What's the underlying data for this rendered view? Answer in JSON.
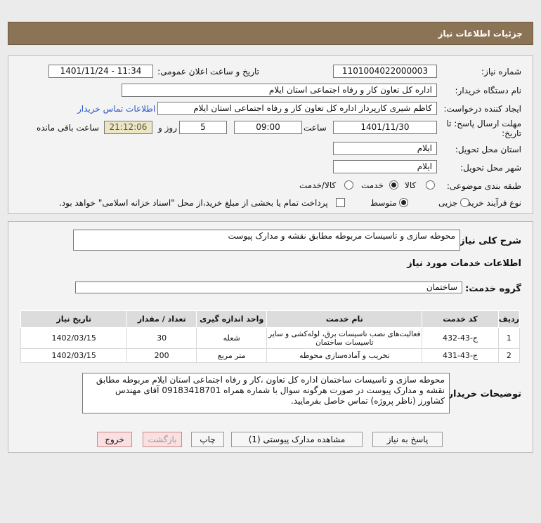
{
  "header": {
    "title": "جزئیات اطلاعات نیاز"
  },
  "form": {
    "need_number_label": "شماره نیاز:",
    "need_number": "1101004022000003",
    "announce_label": "تاریخ و ساعت اعلان عمومی:",
    "announce_value": "1401/11/24 - 11:34",
    "buyer_org_label": "نام دستگاه خریدار:",
    "buyer_org": "اداره کل تعاون  کار و رفاه اجتماعی استان ایلام",
    "requester_label": "ایجاد کننده درخواست:",
    "requester": "کاظم شیری کارپرداز اداره کل تعاون  کار و رفاه اجتماعی استان ایلام",
    "contact_link": "اطلاعات تماس خریدار",
    "deadline_label_1": "مهلت ارسال پاسخ: تا",
    "deadline_label_2": "تاریخ:",
    "deadline_date": "1401/11/30",
    "time_label": "ساعت",
    "deadline_time": "09:00",
    "days_value": "5",
    "days_label": "روز و",
    "remaining_time": "21:12:06",
    "remaining_label": "ساعت باقی مانده",
    "province_label": "استان محل تحویل:",
    "province": "ایلام",
    "city_label": "شهر محل تحویل:",
    "city": "ایلام",
    "category_label": "طبقه بندی موضوعی:",
    "category_options": [
      "کالا",
      "خدمت",
      "کالا/خدمت"
    ],
    "process_label": "نوع فرآیند خرید :",
    "process_options": [
      "جزیی",
      "متوسط"
    ],
    "payment_note": "پرداخت تمام یا بخشی از مبلغ خرید،از محل \"اسناد خزانه اسلامی\" خواهد بود."
  },
  "details": {
    "summary_label": "شرح کلی نیاز:",
    "summary": "محوطه سازی و تاسیسات مربوطه مطابق نقشه و مدارک پیوست",
    "services_title": "اطلاعات خدمات مورد نیاز",
    "service_group_label": "گروه خدمت:",
    "service_group": "ساختمان",
    "table": {
      "headers": [
        "ردیف",
        "کد خدمت",
        "نام خدمت",
        "واحد اندازه گیری",
        "تعداد / مقدار",
        "تاریخ نیاز"
      ],
      "rows": [
        [
          "1",
          "ج-43-432",
          "فعالیت‌های نصب تاسیسات برق، لوله‌کشی و سایر تاسیسات ساختمان",
          "شعله",
          "30",
          "1402/03/15"
        ],
        [
          "2",
          "ج-43-431",
          "تخریب و آماده‌سازی محوطه",
          "متر مربع",
          "200",
          "1402/03/15"
        ]
      ]
    },
    "buyer_notes_label": "توضیحات خریدار:",
    "buyer_notes": "محوطه سازی و تاسیسات ساختمان اداره کل تعاون ،کار و رفاه اجتماعی استان ایلام مربوطه مطابق نقشه و مدارک پیوست در صورت هرگونه سوال با شماره همراه 09183418701 آقای مهندس کشاورز (ناظر پروژه) تماس حاصل بفرمایید."
  },
  "buttons": {
    "reply": "پاسخ به نیاز",
    "view_docs": "مشاهده مدارک پیوستی (1)",
    "print": "چاپ",
    "back": "بازگشت",
    "exit": "خروج"
  }
}
